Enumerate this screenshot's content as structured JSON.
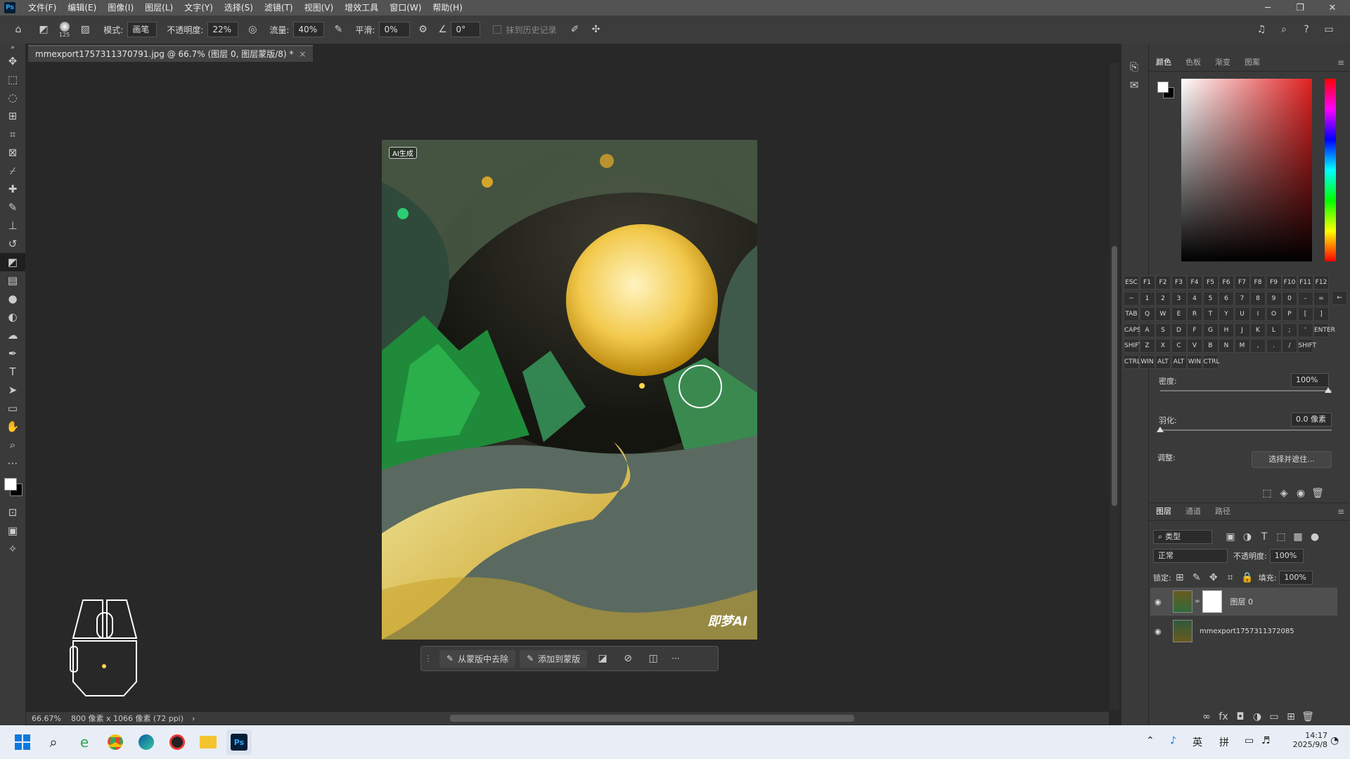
{
  "app": {
    "logo_text": "Ps"
  },
  "menubar": {
    "items": [
      "文件(F)",
      "编辑(E)",
      "图像(I)",
      "图层(L)",
      "文字(Y)",
      "选择(S)",
      "滤镜(T)",
      "视图(V)",
      "增效工具",
      "窗口(W)",
      "帮助(H)"
    ]
  },
  "window_controls": {
    "minimize": "─",
    "restore": "❐",
    "close": "✕"
  },
  "options_bar": {
    "brush_size": "125",
    "mode_label": "模式:",
    "mode_value": "画笔",
    "opacity_label": "不透明度:",
    "opacity_value": "22%",
    "flow_label": "流量:",
    "flow_value": "40%",
    "smooth_label": "平滑:",
    "smooth_value": "0%",
    "angle_value": "0°",
    "history_label": "抹到历史记录"
  },
  "document": {
    "tab_title": "mmexport1757311370791.jpg @ 66.7% (图层 0, 图层蒙版/8) *",
    "tab_close": "×",
    "ai_badge": "AI生成",
    "watermark": "即梦AI"
  },
  "status_bar": {
    "zoom": "66.67%",
    "dimensions": "800 像素 x 1066 像素 (72 ppi)",
    "arrow": "›"
  },
  "context_bar": {
    "remove_label": "从蒙版中去除",
    "add_label": "添加到蒙版",
    "more": "···"
  },
  "color_panel": {
    "tabs": [
      "颜色",
      "色板",
      "渐变",
      "图案"
    ],
    "active_tab": "颜色",
    "hue_accent": "#e02020"
  },
  "keyboard": {
    "row1": [
      "ESC",
      "F1",
      "F2",
      "F3",
      "F4",
      "F5",
      "F6",
      "F7",
      "F8",
      "F9",
      "F10",
      "F11",
      "F12"
    ],
    "row2": [
      "~",
      "1",
      "2",
      "3",
      "4",
      "5",
      "6",
      "7",
      "8",
      "9",
      "0",
      "-",
      "="
    ],
    "row3": [
      "TAB",
      "Q",
      "W",
      "E",
      "R",
      "T",
      "Y",
      "U",
      "I",
      "O",
      "P",
      "[",
      "]"
    ],
    "row4": [
      "CAPS",
      "A",
      "S",
      "D",
      "F",
      "G",
      "H",
      "J",
      "K",
      "L",
      ";",
      "'",
      "ENTER"
    ],
    "row5": [
      "SHIFT",
      "Z",
      "X",
      "C",
      "V",
      "B",
      "N",
      "M",
      ",",
      ".",
      "/",
      "SHIFT"
    ],
    "row6": [
      "CTRL",
      "WIN",
      "ALT",
      "ALT",
      "WIN",
      "CTRL"
    ],
    "backspace": "←"
  },
  "properties_panel": {
    "density_label": "密度:",
    "density_value": "100%",
    "feather_label": "羽化:",
    "feather_value": "0.0 像素",
    "adjust_label": "调整:",
    "select_mask_button": "选择并遮住..."
  },
  "layers_panel": {
    "tabs": [
      "图层",
      "通道",
      "路径"
    ],
    "active_tab": "图层",
    "filter_label": "类型",
    "blend_mode": "正常",
    "opacity_label": "不透明度:",
    "opacity_value": "100%",
    "lock_label": "锁定:",
    "fill_label": "填充:",
    "fill_value": "100%",
    "layers": [
      {
        "name": "图层 0",
        "selected": true
      },
      {
        "name": "mmexport1757311372085",
        "selected": false
      }
    ]
  },
  "taskbar": {
    "ime1": "英",
    "ime2": "拼",
    "time": "14:17",
    "date": "2025/9/8"
  }
}
